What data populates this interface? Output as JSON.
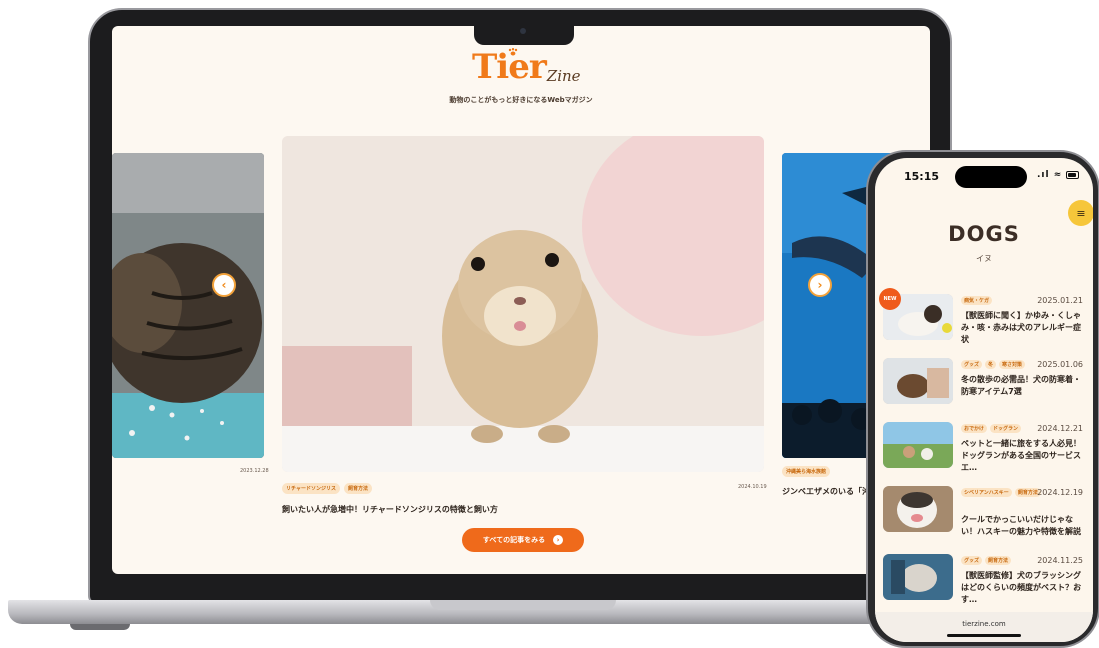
{
  "laptop": {
    "site": {
      "logo_main": "Tier",
      "logo_sub": "Zine",
      "tagline": "動物のことがもっと好きになるWebマガジン",
      "slides": {
        "left": {
          "date": "2023.12.28"
        },
        "main": {
          "tags": [
            "リチャードソンジリス",
            "飼育方法"
          ],
          "date": "2024.10.19",
          "title": "飼いたい人が急増中！リチャードソンジリスの特徴と飼い方"
        },
        "right": {
          "tags": [
            "沖縄美ら海水族館"
          ],
          "title": "ジンベエザメのいる「沖"
        }
      },
      "see_all_label": "すべての記事をみる"
    }
  },
  "phone": {
    "status": {
      "time": "15:15",
      "signal": ".ıl ≈"
    },
    "heading": "DOGS",
    "subheading": "イヌ",
    "new_badge": "NEW",
    "articles": [
      {
        "tags": [
          "病気・ケガ"
        ],
        "date": "2025.01.21",
        "title": "【獣医師に聞く】かゆみ・くしゃみ・咳・赤みは犬のアレルギー症状"
      },
      {
        "tags": [
          "グッズ",
          "冬",
          "寒さ対策"
        ],
        "date": "2025.01.06",
        "title": "冬の散歩の必需品！犬の防寒着・防寒アイテム7選"
      },
      {
        "tags": [
          "おでかけ",
          "ドッグラン"
        ],
        "date": "2024.12.21",
        "title": "ペットと一緒に旅をする人必見！ドッグランがある全国のサービスエ…"
      },
      {
        "tags": [
          "シベリアンハスキー",
          "飼育方法"
        ],
        "date": "2024.12.19",
        "title": "クールでかっこいいだけじゃない！ハスキーの魅力や特徴を解説"
      },
      {
        "tags": [
          "グッズ",
          "飼育方法"
        ],
        "date": "2024.11.25",
        "title": "【獣医師監修】犬のブラッシングはどのくらいの頻度がベスト？おす…"
      }
    ],
    "url": "tierzine.com"
  },
  "colors": {
    "accent": "#ef6a1b",
    "tag_bg": "#fbe3c4",
    "cream_bg": "#fdf8f1"
  }
}
